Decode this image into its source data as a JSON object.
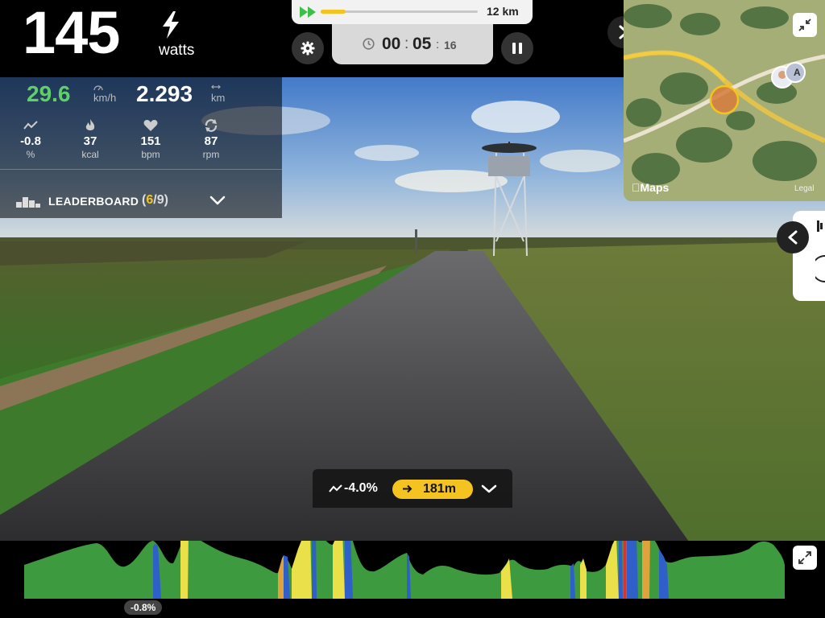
{
  "power": {
    "value": "145",
    "unit": "watts",
    "icon": "lightning-bolt-icon"
  },
  "progress": {
    "distance_label": "12 km",
    "completed_fraction": 0.16
  },
  "timer": {
    "minutes": "00",
    "seconds": "05",
    "centiseconds": "16",
    "sep": ":"
  },
  "controls": {
    "settings_icon": "gear-icon",
    "pause_icon": "pause-icon",
    "next_icon": "chevron-right-icon"
  },
  "stats": {
    "speed": {
      "value": "29.6",
      "unit": "km/h"
    },
    "distance": {
      "value": "2.293",
      "unit": "km"
    },
    "metrics": [
      {
        "value": "-0.8",
        "unit": "%",
        "icon": "slope-icon"
      },
      {
        "value": "37",
        "unit": "kcal",
        "icon": "flame-icon"
      },
      {
        "value": "151",
        "unit": "bpm",
        "icon": "heart-icon"
      },
      {
        "value": "87",
        "unit": "rpm",
        "icon": "cadence-icon"
      }
    ]
  },
  "leaderboard": {
    "label": "LEADERBOARD",
    "open": "(",
    "position": "6",
    "slash": "/",
    "total": "9",
    "close": ")"
  },
  "map": {
    "brand": "Maps",
    "legal": "Legal",
    "badge": "A"
  },
  "gradient": {
    "text": "-4.0%",
    "segment": "181m"
  },
  "profile": {
    "current_grade": "-0.8%"
  },
  "colors": {
    "accent": "#f5c320",
    "speed": "#5fcf6a",
    "profile_green": "#3d9a3e",
    "profile_yellow": "#e9e04a",
    "profile_blue": "#2f5fc8",
    "profile_red": "#d6342d"
  }
}
